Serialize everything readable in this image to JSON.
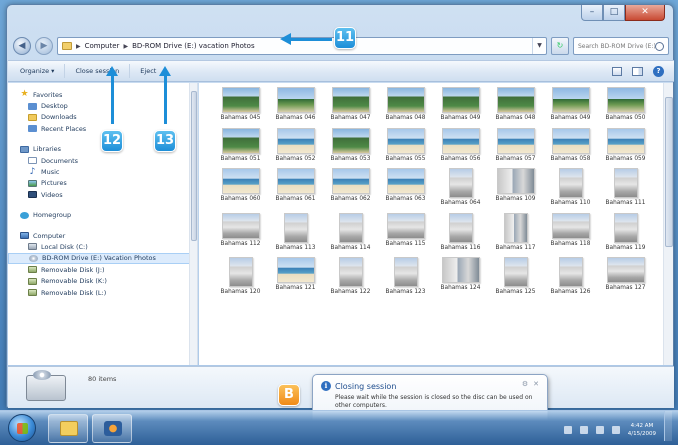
{
  "window": {
    "controls": {
      "minimize": "–",
      "maximize": "□",
      "close": "✕"
    }
  },
  "address": {
    "crumbs": [
      "Computer",
      "BD-ROM Drive (E:) vacation Photos"
    ],
    "search_placeholder": "Search BD-ROM Drive (E:) ..."
  },
  "toolbar": {
    "organize": "Organize ▾",
    "close_session": "Close session",
    "eject": "Eject"
  },
  "nav": {
    "favorites": [
      {
        "label": "Favorites",
        "icon": "favorites-star-icon"
      },
      {
        "label": "Desktop",
        "icon": "desktop-icon"
      },
      {
        "label": "Downloads",
        "icon": "downloads-folder-icon"
      },
      {
        "label": "Recent Places",
        "icon": "recent-places-icon"
      }
    ],
    "libraries": [
      {
        "label": "Libraries",
        "icon": "libraries-icon"
      },
      {
        "label": "Documents",
        "icon": "documents-icon"
      },
      {
        "label": "Music",
        "icon": "music-icon"
      },
      {
        "label": "Pictures",
        "icon": "pictures-icon"
      },
      {
        "label": "Videos",
        "icon": "videos-icon"
      }
    ],
    "homegroup": {
      "label": "Homegroup",
      "icon": "homegroup-icon"
    },
    "computer": [
      {
        "label": "Computer",
        "icon": "computer-icon"
      },
      {
        "label": "Local Disk (C:)",
        "icon": "local-disk-icon"
      },
      {
        "label": "BD-ROM Drive (E:) Vacation Photos",
        "icon": "bd-rom-drive-icon"
      },
      {
        "label": "Removable Disk (J:)",
        "icon": "removable-disk-icon"
      },
      {
        "label": "Removable Disk (K:)",
        "icon": "removable-disk-icon"
      },
      {
        "label": "Removable Disk (L:)",
        "icon": "removable-disk-icon"
      }
    ]
  },
  "files": [
    {
      "name": "Bahamas 045",
      "kind": "palm"
    },
    {
      "name": "Bahamas 046",
      "kind": "beach"
    },
    {
      "name": "Bahamas 047",
      "kind": "palm"
    },
    {
      "name": "Bahamas 048",
      "kind": "palm"
    },
    {
      "name": "Bahamas 049",
      "kind": "palm"
    },
    {
      "name": "Bahamas 048",
      "kind": "palm"
    },
    {
      "name": "Bahamas 049",
      "kind": "beach"
    },
    {
      "name": "Bahamas 050",
      "kind": "beach"
    },
    {
      "name": "Bahamas 051",
      "kind": "palm"
    },
    {
      "name": "Bahamas 052",
      "kind": "sea"
    },
    {
      "name": "Bahamas 053",
      "kind": "palm"
    },
    {
      "name": "Bahamas 055",
      "kind": "sea"
    },
    {
      "name": "Bahamas 056",
      "kind": "sea"
    },
    {
      "name": "Bahamas 057",
      "kind": "sea"
    },
    {
      "name": "Bahamas 058",
      "kind": "sea"
    },
    {
      "name": "Bahamas 059",
      "kind": "sea"
    },
    {
      "name": "Bahamas 060",
      "kind": "sea"
    },
    {
      "name": "Bahamas 061",
      "kind": "sea"
    },
    {
      "name": "Bahamas 062",
      "kind": "sea"
    },
    {
      "name": "Bahamas 063",
      "kind": "sea"
    },
    {
      "name": "Bahamas 064",
      "kind": "bldg"
    },
    {
      "name": "Bahamas 109",
      "kind": "bldg2"
    },
    {
      "name": "Bahamas 110",
      "kind": "bldg"
    },
    {
      "name": "Bahamas 111",
      "kind": "bldg"
    },
    {
      "name": "Bahamas 112",
      "kind": "bldg"
    },
    {
      "name": "Bahamas 113",
      "kind": "bldg"
    },
    {
      "name": "Bahamas 114",
      "kind": "bldg"
    },
    {
      "name": "Bahamas 115",
      "kind": "bldg"
    },
    {
      "name": "Bahamas 116",
      "kind": "bldg"
    },
    {
      "name": "Bahamas 117",
      "kind": "bldg2"
    },
    {
      "name": "Bahamas 118",
      "kind": "bldg"
    },
    {
      "name": "Bahamas 119",
      "kind": "bldg"
    },
    {
      "name": "Bahamas 120",
      "kind": "bldg"
    },
    {
      "name": "Bahamas 121",
      "kind": "sea"
    },
    {
      "name": "Bahamas 122",
      "kind": "bldg"
    },
    {
      "name": "Bahamas 123",
      "kind": "bldg"
    },
    {
      "name": "Bahamas 124",
      "kind": "bldg2"
    },
    {
      "name": "Bahamas 125",
      "kind": "bldg"
    },
    {
      "name": "Bahamas 126",
      "kind": "bldg"
    },
    {
      "name": "Bahamas 127",
      "kind": "bldg"
    }
  ],
  "details": {
    "count": "80 items"
  },
  "balloon": {
    "title": "Closing session",
    "body": "Please wait while the session is closed so the disc can be used on other computers.",
    "icon": "info-icon"
  },
  "callouts": {
    "c11": "11",
    "c12": "12",
    "c13": "13",
    "cB": "B"
  },
  "taskbar": {
    "apps": [
      {
        "icon": "explorer-folder-icon"
      },
      {
        "icon": "media-player-icon"
      }
    ],
    "clock_time": "4:42 AM",
    "clock_date": "4/15/2009"
  },
  "colors": {
    "callout_blue": "#1d8ed8",
    "callout_orange": "#f08a18",
    "selection": "#dcebfc"
  }
}
